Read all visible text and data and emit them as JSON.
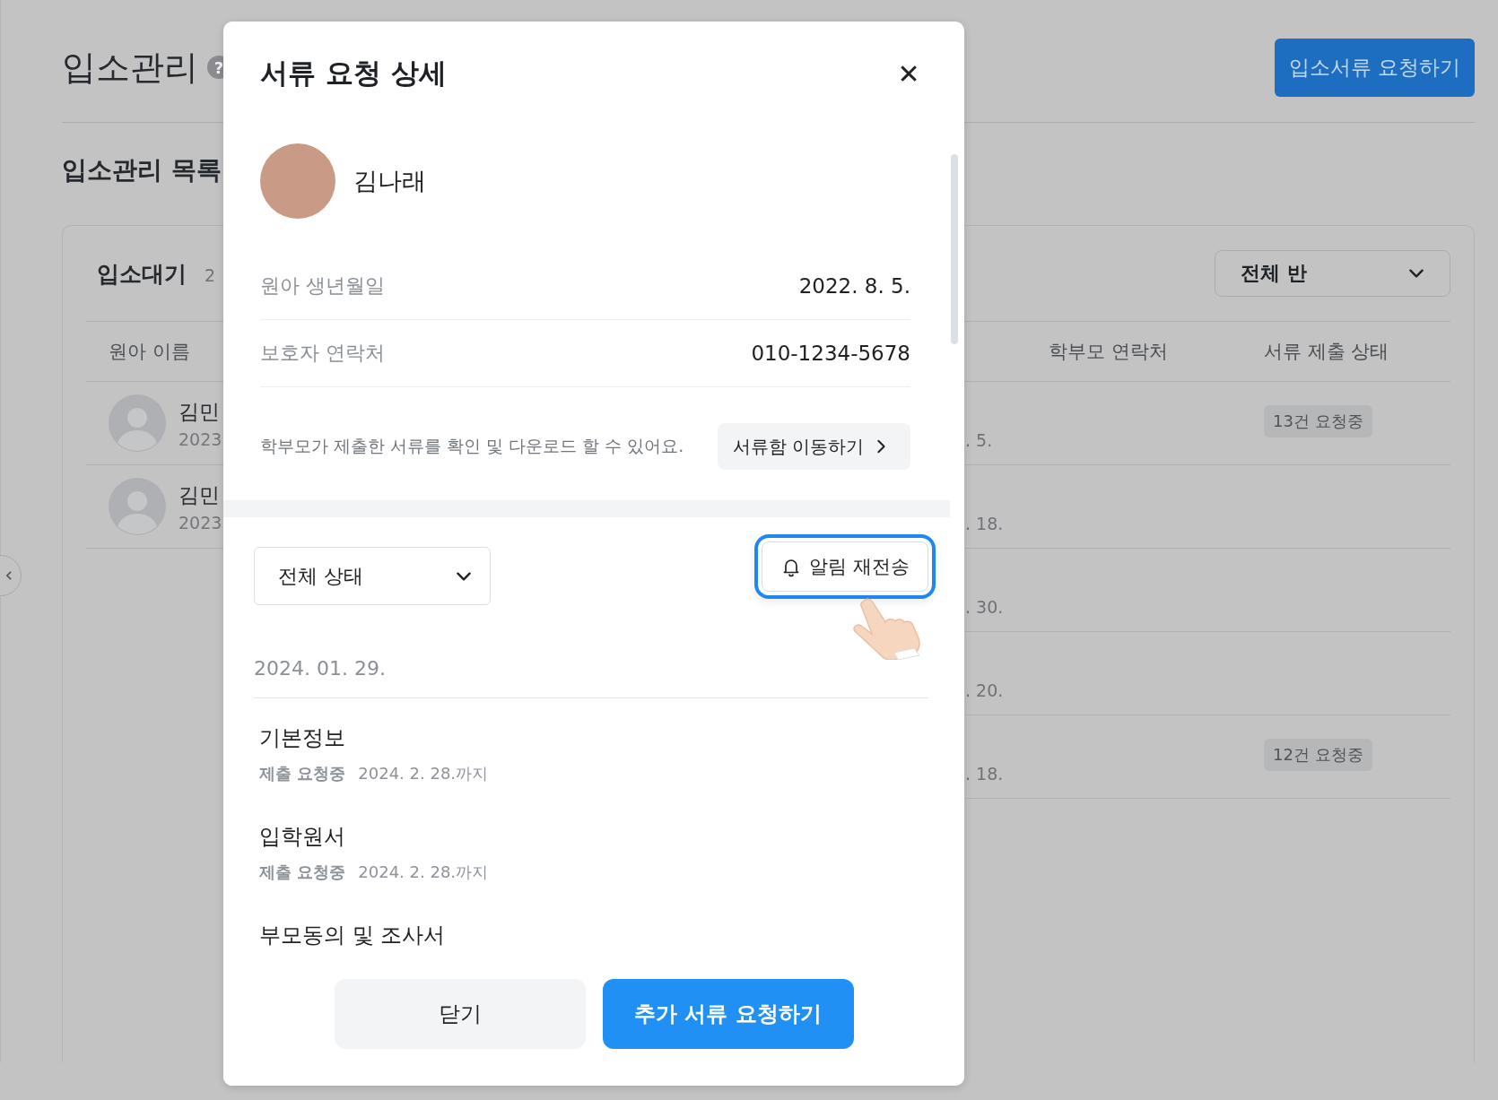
{
  "page": {
    "title": "입소관리",
    "help_mark": "?",
    "request_button": "입소서류 요청하기",
    "list_title": "입소관리 목록"
  },
  "list": {
    "tab_label": "입소대기",
    "tab_count": "2",
    "class_filter": "전체 반",
    "columns": [
      "원아 이름",
      "학부모 연락처",
      "서류 제출 상태"
    ],
    "rows": [
      {
        "name_fragment": "김민",
        "year_fragment": "2023",
        "date_fragment": ". 5.",
        "badge": "13건 요청중"
      },
      {
        "name_fragment": "김민",
        "year_fragment": "2023",
        "date_fragment": ". 18."
      },
      {
        "date_fragment": ". 30."
      },
      {
        "date_fragment": ". 20."
      },
      {
        "date_fragment": ". 18.",
        "badge": "12건 요청중"
      }
    ]
  },
  "modal": {
    "title": "서류 요청 상세",
    "close_mark": "✕",
    "child_name": "김나래",
    "details": [
      {
        "label": "원아 생년월일",
        "value": "2022. 8. 5."
      },
      {
        "label": "보호자 연락처",
        "value": "010-1234-5678"
      }
    ],
    "notice": "학부모가 제출한 서류를 확인 및 다운로드 할 수 있어요.",
    "folder_button": "서류함 이동하기",
    "status_filter": "전체 상태",
    "resend_button": {
      "label": "알림 재전송",
      "highlighted": true
    },
    "date": "2024. 01. 29.",
    "documents": [
      {
        "title": "기본정보",
        "status": "제출 요청중",
        "due": "2024. 2. 28.까지"
      },
      {
        "title": "입학원서",
        "status": "제출 요청중",
        "due": "2024. 2. 28.까지"
      },
      {
        "title": "부모동의 및 조사서"
      }
    ],
    "buttons": [
      {
        "label": "닫기",
        "kind": "secondary"
      },
      {
        "label": "추가 서류 요청하기",
        "kind": "primary"
      }
    ]
  }
}
